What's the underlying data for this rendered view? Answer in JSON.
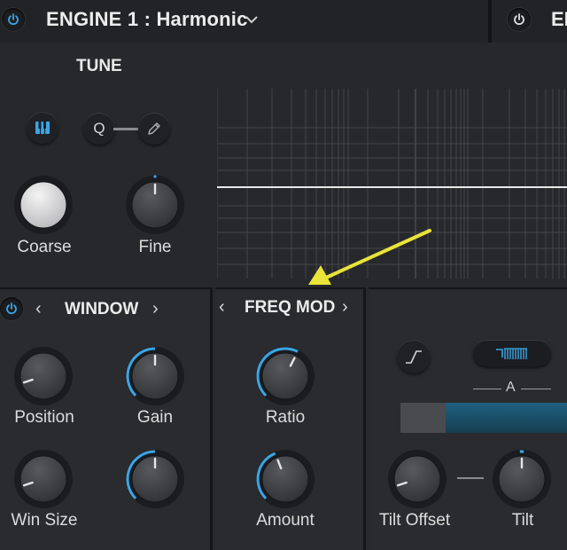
{
  "header": {
    "engine_title": "ENGINE 1 :  Harmonic",
    "engine2_label": "EN"
  },
  "tune": {
    "title": "TUNE",
    "q_label": "Q",
    "coarse": {
      "label": "Coarse",
      "value": 0.5
    },
    "fine": {
      "label": "Fine",
      "value": 0.5
    }
  },
  "window_section": {
    "title": "WINDOW",
    "position": {
      "label": "Position",
      "value": 0.1
    },
    "gain": {
      "label": "Gain",
      "value": 0.5
    },
    "win_size": {
      "label": "Win Size",
      "value": 0.1
    },
    "unlabeled": {
      "value": 0.5
    }
  },
  "freq_mod_section": {
    "title": "FREQ MOD",
    "ratio": {
      "label": "Ratio",
      "value": 0.6
    },
    "amount": {
      "label": "Amount",
      "value": 0.42
    }
  },
  "right_section": {
    "a_label": "A",
    "tilt_offset": {
      "label": "Tilt Offset",
      "value": 0.1
    },
    "tilt": {
      "label": "Tilt",
      "value": 0.5
    },
    "tilt_bar_level": 0.27
  },
  "colors": {
    "accent": "#3aa6e6",
    "arrow": "#e9e43a",
    "background": "#27282b"
  }
}
